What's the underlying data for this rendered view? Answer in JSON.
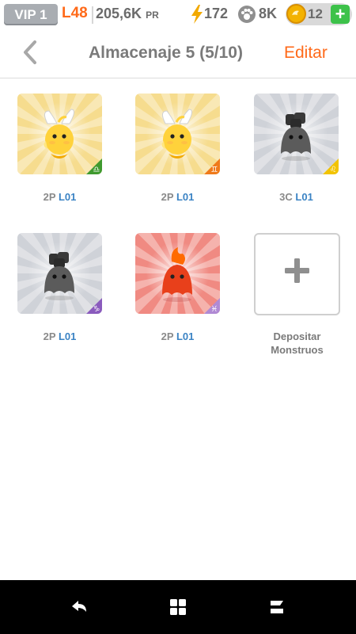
{
  "status": {
    "vip": "VIP 1",
    "level": "L48",
    "pr_value": "205,6K",
    "pr_unit": "PR",
    "energy": "172",
    "food": "8K",
    "coins": "12",
    "add": "+"
  },
  "header": {
    "title": "Almacenaje 5 (5/10)",
    "edit": "Editar"
  },
  "monsters": [
    {
      "rank": "2P",
      "level": "L01",
      "element": "light",
      "sign": "libra",
      "badge_color": "#3f9a2f",
      "bg": "#f6dc8e"
    },
    {
      "rank": "2P",
      "level": "L01",
      "element": "light",
      "sign": "gemini",
      "badge_color": "#ef7a1a",
      "bg": "#f6dc8e"
    },
    {
      "rank": "3C",
      "level": "L01",
      "element": "dark",
      "sign": "leo",
      "badge_color": "#f2c300",
      "bg": "#cfd2d8"
    },
    {
      "rank": "2P",
      "level": "L01",
      "element": "dark",
      "sign": "capricorn",
      "badge_color": "#8a5bbd",
      "bg": "#cfd2d8"
    },
    {
      "rank": "2P",
      "level": "L01",
      "element": "fire",
      "sign": "pisces",
      "badge_color": "#b08ad4",
      "bg": "#f08a82"
    }
  ],
  "deposit": {
    "line1": "Depositar",
    "line2": "Monstruos"
  }
}
